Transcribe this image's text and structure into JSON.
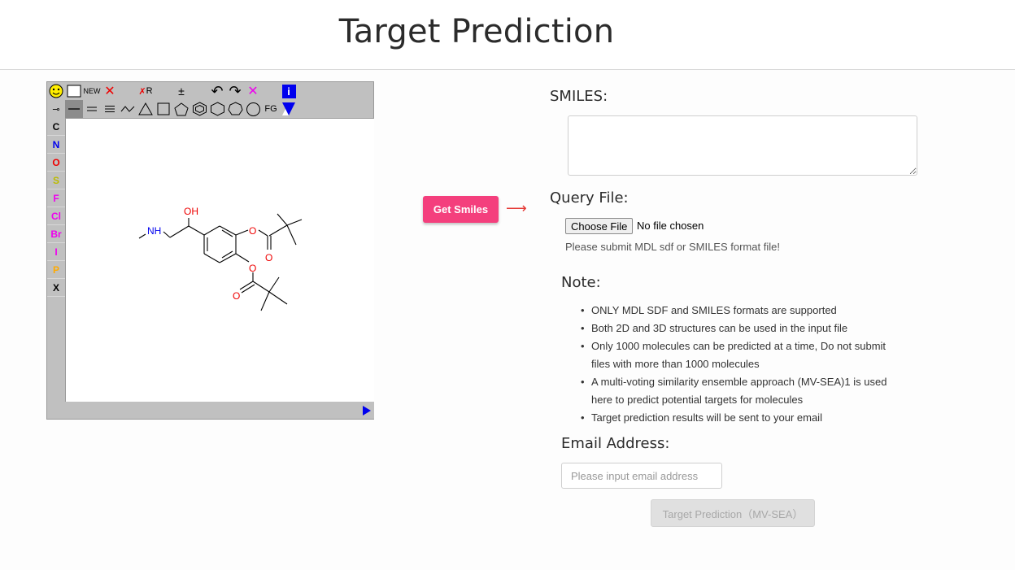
{
  "page": {
    "title": "Target Prediction"
  },
  "editor": {
    "toolbar_row1": [
      {
        "name": "smiley-icon",
        "text": "🙂"
      },
      {
        "name": "blank-frame-icon",
        "text": "▢"
      },
      {
        "name": "new-button",
        "text": "NEW"
      },
      {
        "name": "delete-icon",
        "text": "✕"
      },
      {
        "name": "spacer-1",
        "text": ""
      },
      {
        "name": "delete-group-icon",
        "text": "✗R"
      },
      {
        "name": "spacer-2",
        "text": ""
      },
      {
        "name": "charge-icon",
        "text": "±"
      },
      {
        "name": "spacer-3",
        "text": ""
      },
      {
        "name": "undo-icon",
        "text": "↶"
      },
      {
        "name": "redo-icon",
        "text": "↷"
      },
      {
        "name": "clear-icon",
        "text": "✕"
      },
      {
        "name": "spacer-4",
        "text": ""
      },
      {
        "name": "info-icon",
        "text": "i"
      }
    ],
    "toolbar_row2": [
      {
        "name": "stereo-bond-icon",
        "text": "⊸"
      },
      {
        "name": "single-bond-icon",
        "text": "—"
      },
      {
        "name": "double-bond-icon",
        "text": "="
      },
      {
        "name": "triple-bond-icon",
        "text": "≡"
      },
      {
        "name": "chain-icon",
        "text": "〜"
      },
      {
        "name": "ring3-icon",
        "text": "△"
      },
      {
        "name": "ring4-icon",
        "text": "□"
      },
      {
        "name": "ring5-icon",
        "text": "⬠"
      },
      {
        "name": "benzene-icon",
        "text": "⏣"
      },
      {
        "name": "ring6-icon",
        "text": "⬡"
      },
      {
        "name": "ring7-icon",
        "text": "⬡"
      },
      {
        "name": "ring8-icon",
        "text": "◯"
      },
      {
        "name": "fg-button",
        "text": "FG"
      },
      {
        "name": "template-icon",
        "text": "▼"
      }
    ],
    "atoms": [
      {
        "label": "C",
        "color": "#000000"
      },
      {
        "label": "N",
        "color": "#0000ee"
      },
      {
        "label": "O",
        "color": "#ee0000"
      },
      {
        "label": "S",
        "color": "#bbbb00"
      },
      {
        "label": "F",
        "color": "#ee00ee"
      },
      {
        "label": "Cl",
        "color": "#ee00ee"
      },
      {
        "label": "Br",
        "color": "#ee00ee"
      },
      {
        "label": "I",
        "color": "#ee00ee"
      },
      {
        "label": "P",
        "color": "#ffaa00"
      },
      {
        "label": "X",
        "color": "#000000"
      }
    ],
    "molecule_labels": {
      "nh": "NH",
      "oh": "OH",
      "o1": "O",
      "o2": "O",
      "o3": "O",
      "o4": "O"
    }
  },
  "get_smiles_label": "Get Smiles",
  "arrow_glyph": "⟶",
  "smiles": {
    "label": "SMILES:",
    "value": ""
  },
  "query_file": {
    "label": "Query File:",
    "button": "Choose File",
    "status": "No file chosen",
    "hint": "Please submit MDL sdf or SMILES format file!"
  },
  "note": {
    "label": "Note:",
    "items": [
      "ONLY MDL SDF and SMILES formats are supported",
      "Both 2D and 3D structures can be used in the input file",
      "Only 1000 molecules can be predicted at a time, Do not submit files with more than 1000 molecules",
      "A multi-voting similarity ensemble approach (MV-SEA)1 is used here to predict potential targets for molecules",
      "Target prediction results will be sent to your email"
    ]
  },
  "email": {
    "label": "Email Address:",
    "placeholder": "Please input email address"
  },
  "predict_button": "Target Prediction（MV-SEA）",
  "colors": {
    "accent": "#f43f7d",
    "arrow": "#e53935"
  }
}
